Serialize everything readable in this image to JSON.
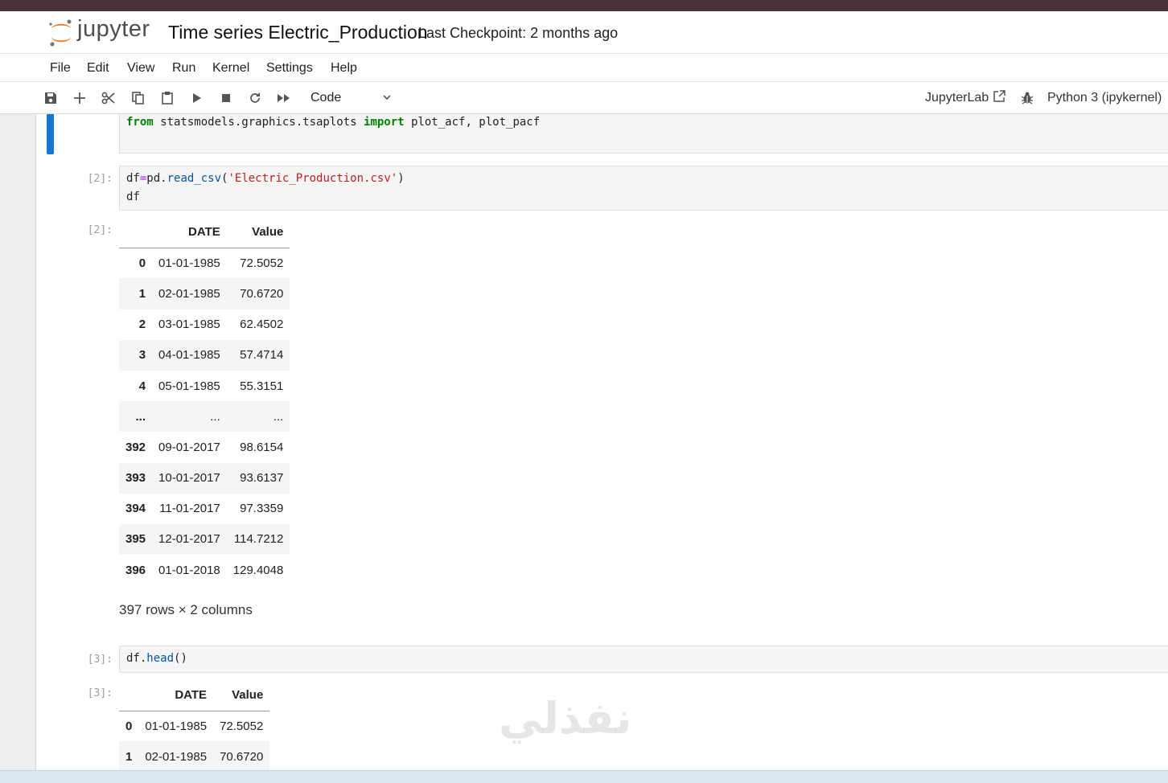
{
  "header": {
    "logo_text": "jupyter",
    "notebook_title": "Time series Electric_Production",
    "checkpoint": "Last Checkpoint: 2 months ago"
  },
  "menu": [
    "File",
    "Edit",
    "View",
    "Run",
    "Kernel",
    "Settings",
    "Help"
  ],
  "toolbar": {
    "cell_type": "Code",
    "jupyterlab_label": "JupyterLab",
    "kernel_label": "Python 3 (ipykernel)",
    "icons": [
      "save-icon",
      "add-cell-icon",
      "cut-icon",
      "copy-icon",
      "paste-icon",
      "run-icon",
      "stop-icon",
      "restart-icon",
      "fast-forward-icon",
      "chevron-down-icon",
      "external-link-icon",
      "bug-icon"
    ]
  },
  "cells": {
    "cell1": {
      "code": {
        "kw_from": "from",
        "module": " statsmodels.graphics.tsaplots ",
        "kw_import": "import",
        "names": " plot_acf, plot_pacf"
      }
    },
    "cell2": {
      "prompt_in": "[2]:",
      "prompt_out": "[2]:",
      "code": {
        "p1": "df",
        "eq": "=",
        "p2": "pd.",
        "fn": "read_csv",
        "p3": "(",
        "str": "'Electric_Production.csv'",
        "p4": ")",
        "line2": "df"
      },
      "table": {
        "columns": [
          "",
          "DATE",
          "Value"
        ],
        "rows": [
          [
            "0",
            "01-01-1985",
            "72.5052"
          ],
          [
            "1",
            "02-01-1985",
            "70.6720"
          ],
          [
            "2",
            "03-01-1985",
            "62.4502"
          ],
          [
            "3",
            "04-01-1985",
            "57.4714"
          ],
          [
            "4",
            "05-01-1985",
            "55.3151"
          ],
          [
            "...",
            "...",
            "..."
          ],
          [
            "392",
            "09-01-2017",
            "98.6154"
          ],
          [
            "393",
            "10-01-2017",
            "93.6137"
          ],
          [
            "394",
            "11-01-2017",
            "97.3359"
          ],
          [
            "395",
            "12-01-2017",
            "114.7212"
          ],
          [
            "396",
            "01-01-2018",
            "129.4048"
          ]
        ]
      },
      "summary": "397 rows × 2 columns"
    },
    "cell3": {
      "prompt_in": "[3]:",
      "prompt_out": "[3]:",
      "code": {
        "p1": "df.",
        "fn": "head",
        "p2": "()"
      },
      "table": {
        "columns": [
          "",
          "DATE",
          "Value"
        ],
        "rows": [
          [
            "0",
            "01-01-1985",
            "72.5052"
          ],
          [
            "1",
            "02-01-1985",
            "70.6720"
          ]
        ]
      }
    }
  },
  "watermark": "نفذلي",
  "colors": {
    "accent": "#1976d2",
    "top_strip": "#4a3137",
    "keyword": "#008000",
    "string": "#ba2121",
    "logo_orange": "#f37726"
  }
}
